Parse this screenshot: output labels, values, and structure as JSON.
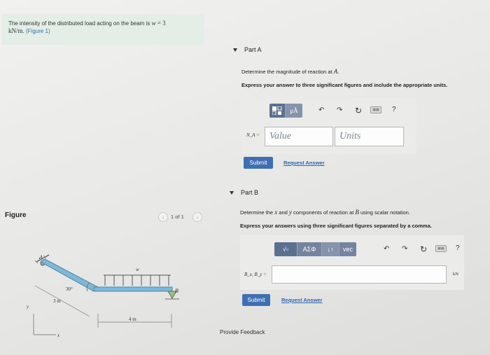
{
  "problem": {
    "text_before": "The intensity of the distributed load acting on the beam is",
    "variable": "w",
    "equals_value": "= 3",
    "units": "kN/m",
    "separator": ".",
    "figure_link": "(Figure 1)"
  },
  "part_a": {
    "header": "Part A",
    "instruction": "Determine the magnitude of reaction at",
    "instruction_point": "A",
    "instruction_end": ".",
    "express": "Express your answer to three significant figures and include the appropriate units.",
    "toolbar": {
      "btn_matrix_icon": "matrix-template-icon",
      "btn_mu": "μÅ",
      "undo": "↶",
      "redo": "↷",
      "reset": "↻",
      "keyboard": "▭",
      "help": "?"
    },
    "var_label": "N_A =",
    "value_placeholder": "Value",
    "units_placeholder": "Units",
    "submit": "Submit",
    "request_answer": "Request Answer"
  },
  "part_b": {
    "header": "Part B",
    "instruction_start": "Determine the",
    "instruction_x": "x",
    "instruction_and": "and",
    "instruction_y": "y",
    "instruction_end": "components of reaction at",
    "instruction_point": "B",
    "instruction_tail": "using scalar notation.",
    "express": "Express your answers using three significant figures separated by a comma.",
    "toolbar": {
      "btn_sqrt": "√▫",
      "btn_greek": "ΑΣΦ",
      "btn_arrows": "↓↑",
      "btn_vec": "vec",
      "undo": "↶",
      "redo": "↷",
      "reset": "↻",
      "keyboard": "▭",
      "help": "?"
    },
    "var_label": "B_x, B_y =",
    "units_suffix": "kN",
    "submit": "Submit",
    "request_answer": "Request Answer"
  },
  "figure": {
    "title": "Figure",
    "pager": "1 of 1",
    "prev": "‹",
    "next": "›",
    "labels": {
      "A": "A",
      "B": "B",
      "w": "w",
      "angle": "30°",
      "len_inclined": "3 m",
      "len_horizontal": "4 m",
      "axis_x": "x",
      "axis_y": "y"
    }
  },
  "feedback": "Provide Feedback",
  "colors": {
    "primary_button": "#3f6fb2",
    "toolbar_button": "#5b6f8f",
    "problem_bg": "#e4ede6",
    "beam": "#7fb7d6"
  }
}
